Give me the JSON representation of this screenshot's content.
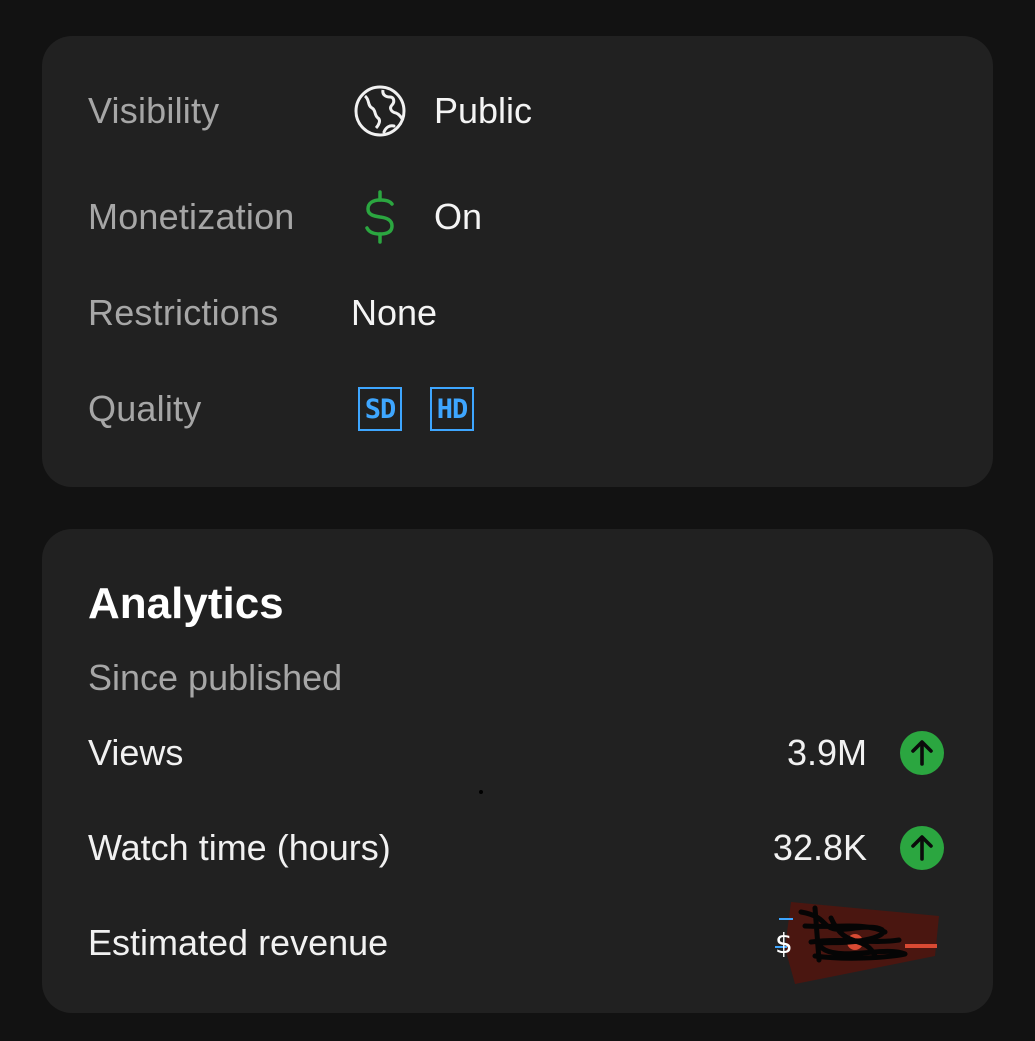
{
  "details": {
    "visibility": {
      "label": "Visibility",
      "value": "Public",
      "icon": "globe-icon"
    },
    "monetization": {
      "label": "Monetization",
      "value": "On",
      "icon": "dollar-icon",
      "icon_color": "#2ba640"
    },
    "restrictions": {
      "label": "Restrictions",
      "value": "None"
    },
    "quality": {
      "label": "Quality",
      "badges": [
        "SD",
        "HD"
      ],
      "badge_color": "#3ea6ff"
    }
  },
  "analytics": {
    "title": "Analytics",
    "subtitle": "Since published",
    "stats": [
      {
        "label": "Views",
        "value": "3.9M",
        "trend_icon": "arrow-up-circle-icon"
      },
      {
        "label": "Watch time (hours)",
        "value": "32.8K",
        "trend_icon": "arrow-up-circle-icon"
      },
      {
        "label": "Estimated revenue",
        "value": "",
        "redacted": true
      }
    ],
    "trend_color": "#2ba640"
  },
  "colors": {
    "background": "#121212",
    "card": "#212121",
    "label": "#a6a6a6",
    "text": "#f1f1f1"
  }
}
